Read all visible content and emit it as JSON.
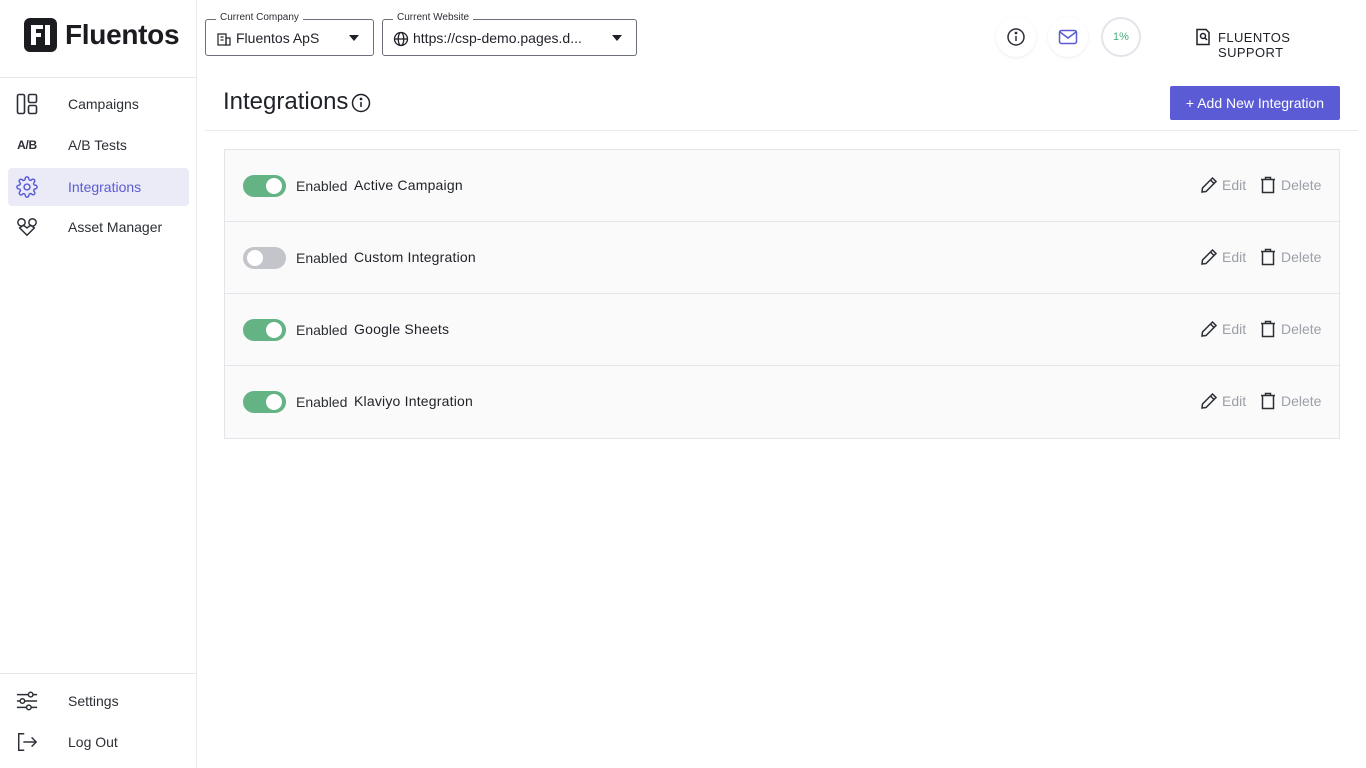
{
  "brand": {
    "name": "Fluentos"
  },
  "sidebar": {
    "items": [
      {
        "label": "Campaigns",
        "icon": "campaigns-icon"
      },
      {
        "label": "A/B Tests",
        "icon": "ab-tests-icon",
        "icon_text": "A/B"
      },
      {
        "label": "Integrations",
        "icon": "gear-icon",
        "active": true
      },
      {
        "label": "Asset Manager",
        "icon": "asset-manager-icon"
      }
    ],
    "bottom_items": [
      {
        "label": "Settings",
        "icon": "sliders-icon"
      },
      {
        "label": "Log Out",
        "icon": "logout-icon"
      }
    ]
  },
  "header": {
    "company_select": {
      "legend": "Current Company",
      "value": "Fluentos ApS"
    },
    "website_select": {
      "legend": "Current Website",
      "value": "https://csp-demo.pages.d..."
    },
    "progress": {
      "text": "1%",
      "value": 1
    },
    "support_label": "FLUENTOS SUPPORT"
  },
  "main": {
    "title": "Integrations",
    "add_button_label": "+ Add New Integration",
    "enabled_label": "Enabled",
    "edit_label": "Edit",
    "delete_label": "Delete",
    "integrations": [
      {
        "name": "Active Campaign",
        "enabled": true
      },
      {
        "name": "Custom Integration",
        "enabled": false
      },
      {
        "name": "Google Sheets",
        "enabled": true
      },
      {
        "name": "Klaviyo Integration",
        "enabled": true
      }
    ]
  },
  "colors": {
    "accent": "#5b5bd6",
    "toggle_on": "#63b384",
    "toggle_off": "#c3c5cb",
    "active_nav_bg": "#ebebf7"
  }
}
